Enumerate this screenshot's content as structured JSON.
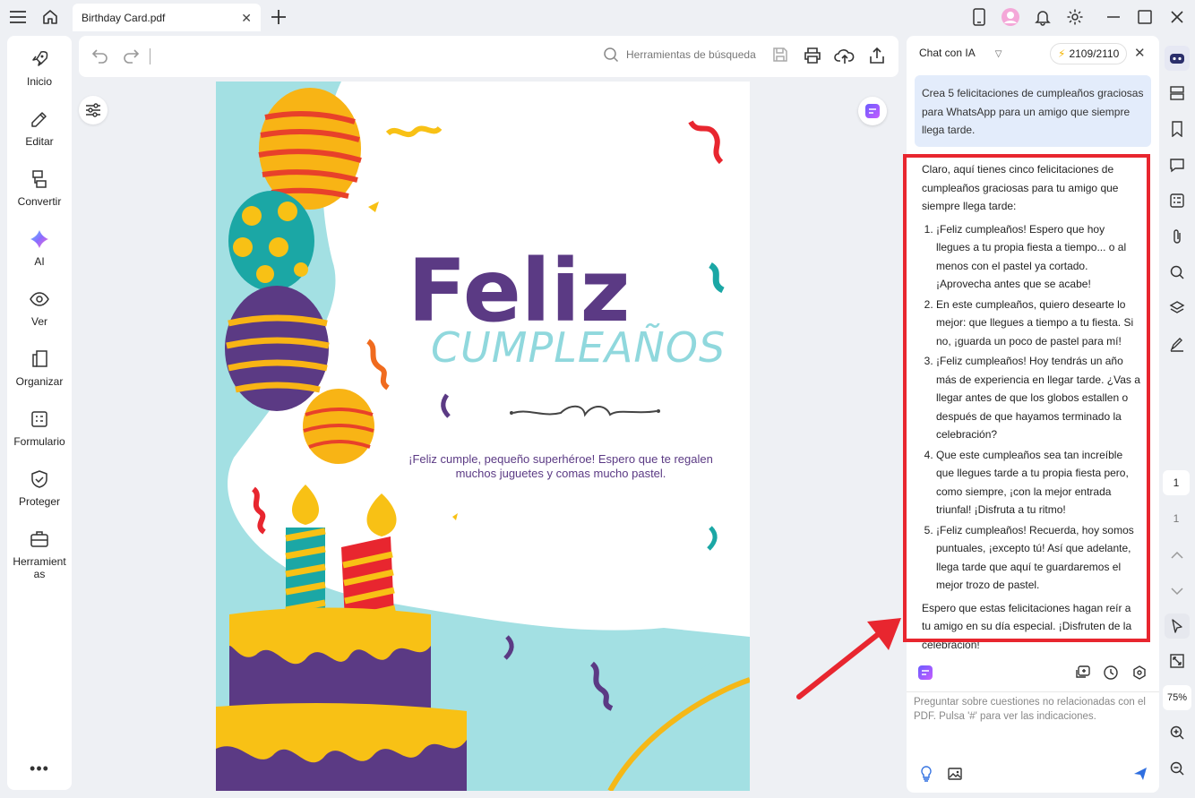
{
  "window": {
    "tab_title": "Birthday Card.pdf"
  },
  "left_nav": {
    "items": [
      {
        "label": "Inicio",
        "icon": "rocket-icon"
      },
      {
        "label": "Editar",
        "icon": "edit-icon"
      },
      {
        "label": "Convertir",
        "icon": "convert-icon"
      },
      {
        "label": "AI",
        "icon": "ai-icon"
      },
      {
        "label": "Ver",
        "icon": "eye-icon"
      },
      {
        "label": "Organizar",
        "icon": "organize-icon"
      },
      {
        "label": "Formulario",
        "icon": "form-icon"
      },
      {
        "label": "Proteger",
        "icon": "shield-icon"
      },
      {
        "label": "Herramientas",
        "icon": "toolbox-icon"
      }
    ],
    "more_label": "•••"
  },
  "toolbar": {
    "search_placeholder": "Herramientas de búsqueda"
  },
  "document": {
    "title": "Feliz",
    "subtitle": "CUMPLEAÑOS",
    "message": "¡Feliz cumple, pequeño superhéroe! Espero que te regalen muchos juguetes y comas mucho pastel."
  },
  "chat": {
    "title": "Chat con IA",
    "credits": "2109/2110",
    "user_message": "Crea 5 felicitaciones de cumpleaños graciosas para WhatsApp para un amigo que siempre llega tarde.",
    "ai_intro": "Claro, aquí tienes cinco felicitaciones de cumpleaños graciosas para tu amigo que siempre llega tarde:",
    "ai_items": [
      "¡Feliz cumpleaños! Espero que hoy llegues a tu propia fiesta a tiempo... o al menos con el pastel ya cortado. ¡Aprovecha antes que se acabe!",
      "En este cumpleaños, quiero desearte lo mejor: que llegues a tiempo a tu fiesta. Si no, ¡guarda un poco de pastel para mí!",
      "¡Feliz cumpleaños! Hoy tendrás un año más de experiencia en llegar tarde. ¿Vas a llegar antes de que los globos estallen o después de que hayamos terminado la celebración?",
      "Que este cumpleaños sea tan increíble que llegues tarde a tu propia fiesta pero, como siempre, ¡con la mejor entrada triunfal! ¡Disfruta a tu ritmo!",
      "¡Feliz cumpleaños! Recuerda, hoy somos puntuales, ¡excepto tú! Así que adelante, llega tarde que aquí te guardaremos el mejor trozo de pastel."
    ],
    "ai_outro": "Espero que estas felicitaciones hagan reír a tu amigo en su día especial. ¡Disfruten de la celebración!",
    "input_placeholder": "Preguntar sobre cuestiones no relacionadas con el PDF. Pulsa '#' para ver las indicaciones."
  },
  "right_rail": {
    "current_page": "1",
    "total_pages": "1",
    "zoom": "75%"
  },
  "colors": {
    "accent_red": "#e8262f",
    "card_purple": "#5b3a84",
    "card_teal": "#90d8dd",
    "user_bubble": "#e3ecfb"
  }
}
